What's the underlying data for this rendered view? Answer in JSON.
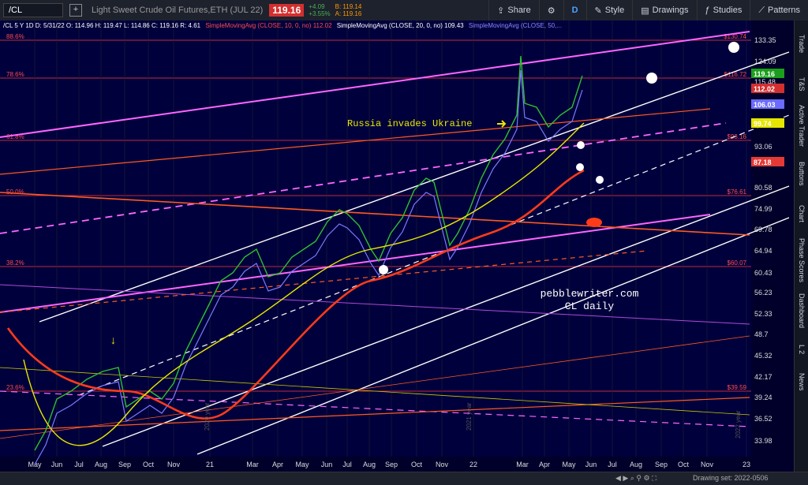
{
  "toolbar": {
    "symbol": "/CL",
    "add_label": "+",
    "title": "Light Sweet Crude Oil Futures,ETH (JUL 22)",
    "price": "119.16",
    "change_abs": "+4.09",
    "change_pct": "+3.55%",
    "bid": "B: 119.14",
    "ask": "A: 119.16",
    "share": "Share",
    "style": "Style",
    "drawings": "Drawings",
    "studies": "Studies",
    "patterns": "Patterns",
    "indicator_letter": "D"
  },
  "legend": {
    "main": "/CL 5 Y 1D  D: 5/31/22  O: 114.96  H: 119.47  L: 114.86  C: 119.16  R: 4.61",
    "sma10": "SimpleMovingAvg (CLOSE, 10, 0, no)  112.02",
    "sma20": "SimpleMovingAvg (CLOSE, 20, 0, no)  109.43",
    "sma50": "SimpleMovingAvg (CLOSE, 50,..."
  },
  "fib": [
    {
      "pct": "88.6%",
      "price": "$130.74"
    },
    {
      "pct": "78.6%",
      "price": "$116.72"
    },
    {
      "pct": "61.8%",
      "price": "$93.16"
    },
    {
      "pct": "50.0%",
      "price": "$76.61"
    },
    {
      "pct": "38.2%",
      "price": "$60.07"
    },
    {
      "pct": "23.6%",
      "price": "$39.59"
    }
  ],
  "y_ticks": [
    "133.35",
    "124.09",
    "115.48",
    "93.06",
    "80.58",
    "74.99",
    "69.78",
    "64.94",
    "60.43",
    "56.23",
    "52.33",
    "48.7",
    "45.32",
    "42.17",
    "39.24",
    "36.52",
    "33.98"
  ],
  "price_labels": [
    {
      "v": "119.16",
      "c": "#1b9e1b"
    },
    {
      "v": "112.02",
      "c": "#d32f2f"
    },
    {
      "v": "106.03",
      "c": "#6b6bff"
    },
    {
      "v": "99.74",
      "c": "#e5e500"
    },
    {
      "v": "87.18",
      "c": "#e53935"
    }
  ],
  "x_labels": [
    "May",
    "Jun",
    "Jul",
    "Aug",
    "Sep",
    "Oct",
    "Nov",
    "21",
    "Mar",
    "Apr",
    "May",
    "Jun",
    "Jul",
    "Aug",
    "Sep",
    "Oct",
    "Nov",
    "22",
    "Mar",
    "Apr",
    "May",
    "Jun",
    "Jul",
    "Aug",
    "Sep",
    "Oct",
    "Nov",
    "23"
  ],
  "annotations": {
    "event": "Russia invades Ukraine",
    "site": "pebblewriter.com",
    "sub": "CL daily",
    "y2021": "2021 year",
    "y2020": "2020 year",
    "y2022": "2022 year"
  },
  "right_tabs": [
    "Trade",
    "T&S",
    "Active Trader",
    "Buttons",
    "Chart",
    "Phase Scores",
    "Dashboard",
    "L 2",
    "News"
  ],
  "status": {
    "drawing_set": "Drawing set: 2022-0506"
  },
  "colors": {
    "bg": "#00003c",
    "magenta": "#ff66ff",
    "orange": "#ff5a1f",
    "fib": "#ff4d4d",
    "white": "#ffffff",
    "yellow": "#e8e800"
  }
}
